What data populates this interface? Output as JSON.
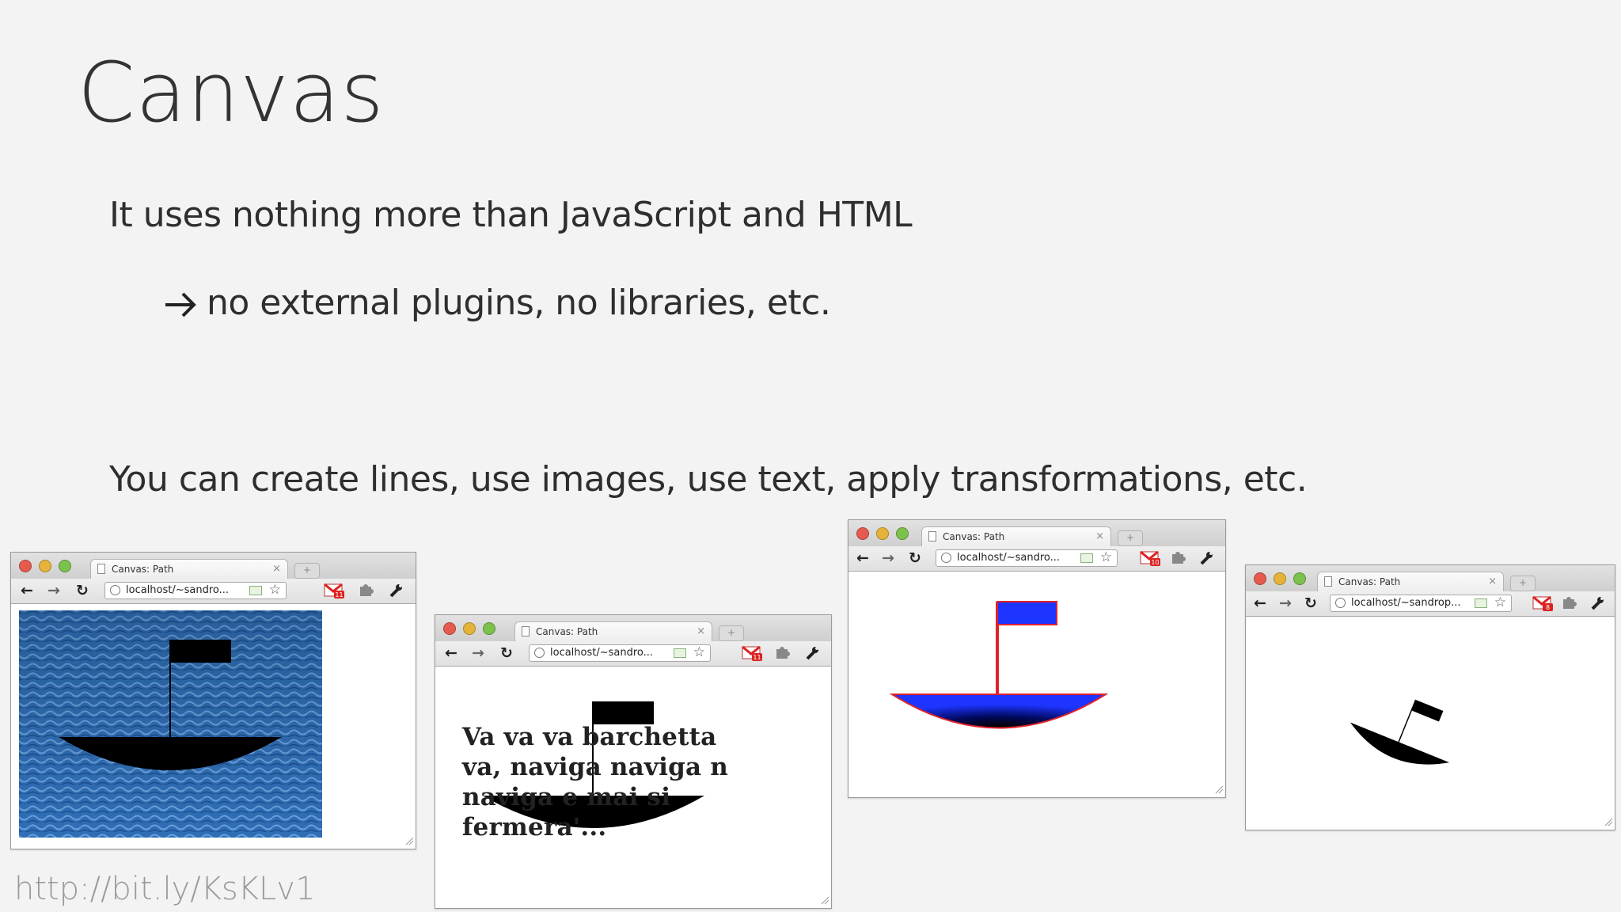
{
  "slide": {
    "title": "Canvas",
    "line1": "It uses nothing more than JavaScript and HTML",
    "line2": "no external plugins, no libraries, etc.",
    "line3": "You can create lines, use images, use text, apply transformations, etc.",
    "url": "http://bit.ly/KsKLv1"
  },
  "browser": {
    "tab_title": "Canvas: Path",
    "address": "localhost/~sandro...",
    "address_alt": "localhost/~sandrop...",
    "gmail_badge_1": "11",
    "gmail_badge_2": "10",
    "gmail_badge_3": "8"
  },
  "demo2": {
    "text": "Va va va barchetta va, naviga naviga n naviga e mai si fermera'..."
  },
  "colors": {
    "flag_blue": "#1e34ff",
    "outline_red": "#e0222a",
    "sea_blue": "#2e6fb8"
  }
}
